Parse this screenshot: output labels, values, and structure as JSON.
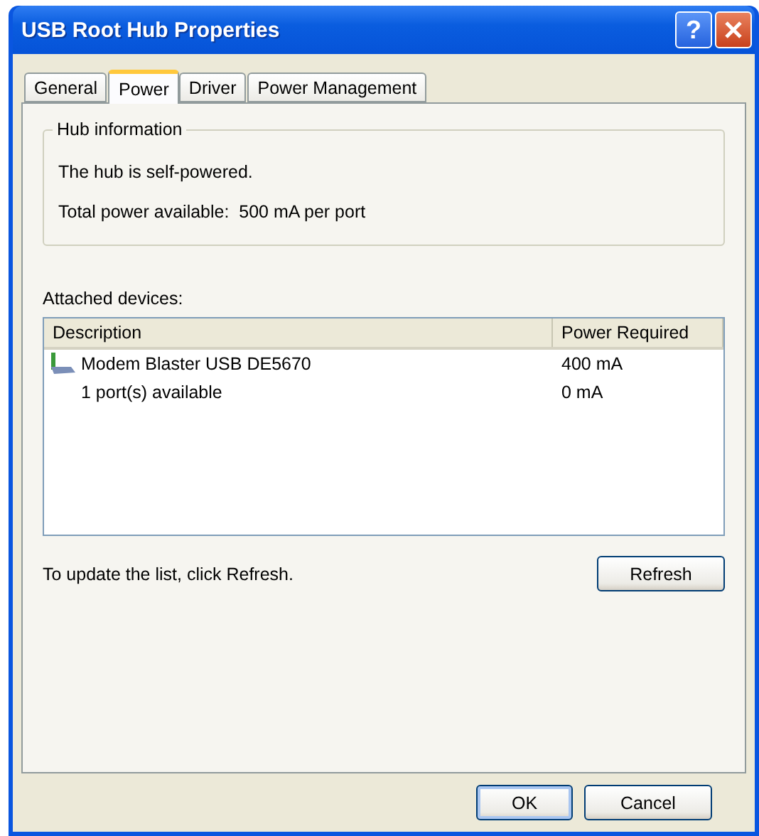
{
  "window": {
    "title": "USB Root Hub Properties",
    "help_button": "?"
  },
  "tabs": [
    {
      "label": "General",
      "selected": false
    },
    {
      "label": "Power",
      "selected": true
    },
    {
      "label": "Driver",
      "selected": false
    },
    {
      "label": "Power Management",
      "selected": false
    }
  ],
  "hub_information": {
    "title": "Hub information",
    "lines": [
      "The hub is self-powered.",
      "Total power available:  500 mA per port"
    ]
  },
  "attached_devices": {
    "label": "Attached devices:",
    "columns": [
      "Description",
      "Power Required"
    ],
    "rows": [
      {
        "kind": "device",
        "description": "Modem Blaster USB DE5670",
        "power": "400 mA"
      },
      {
        "kind": "ports",
        "description": "1 port(s) available",
        "power": "0 mA"
      }
    ]
  },
  "hint": "To update the list, click Refresh.",
  "refresh_button": "Refresh",
  "buttons": [
    "OK",
    "Cancel"
  ]
}
